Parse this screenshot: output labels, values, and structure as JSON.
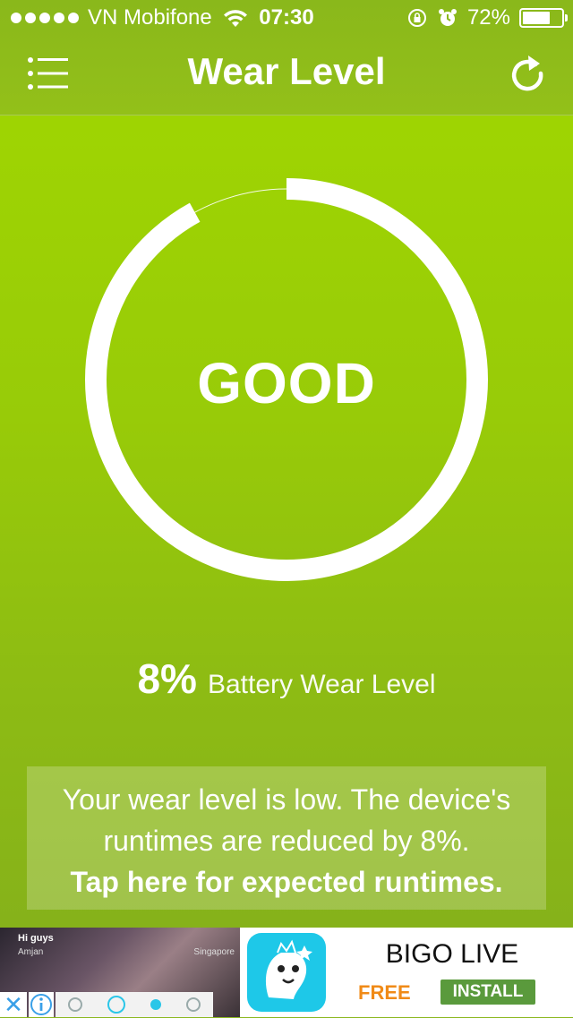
{
  "status_bar": {
    "carrier": "VN Mobifone",
    "time": "07:30",
    "battery_percent": "72%",
    "battery_level": 0.72,
    "icons": [
      "signal-dots-icon",
      "wifi-icon",
      "rotation-lock-icon",
      "alarm-icon",
      "battery-icon"
    ]
  },
  "header": {
    "title": "Wear Level",
    "menu_icon": "list-menu-icon",
    "refresh_icon": "refresh-icon"
  },
  "gauge": {
    "status": "GOOD",
    "wear_fraction": 0.08,
    "colors": {
      "ring": "#ffffff",
      "background": "#a1d800"
    }
  },
  "wear": {
    "percent": "8%",
    "label": "Battery Wear Level"
  },
  "info": {
    "line1": "Your wear level is low. The device's",
    "line2": "runtimes are reduced by 8%.",
    "link": "Tap here for expected runtimes."
  },
  "ad": {
    "media": {
      "greeting": "Hi guys",
      "user": "Amjan",
      "location": "Singapore"
    },
    "app_name": "BIGO LIVE",
    "price": "FREE",
    "install_label": "INSTALL",
    "close_icon": "close-icon",
    "info_icon": "info-icon",
    "colors": {
      "free": "#f08a17",
      "install": "#5a9a3c"
    }
  }
}
